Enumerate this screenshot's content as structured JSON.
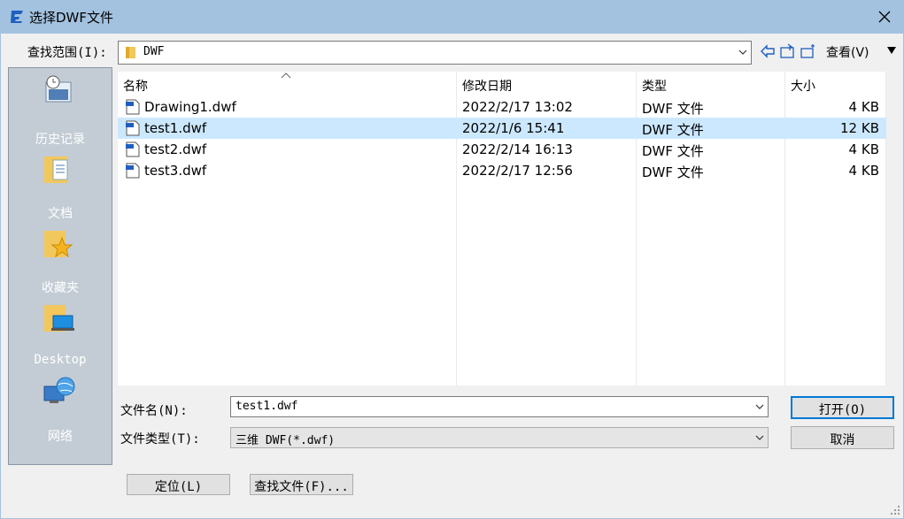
{
  "window": {
    "title": "选择DWF文件",
    "titlebar_color": "#a3c2e0",
    "icon": "app-logo-icon"
  },
  "lookin": {
    "label": "查找范围(I):",
    "value": "DWF"
  },
  "toolbar": {
    "views_label": "查看(V)",
    "icons": [
      "back-arrow-icon",
      "up-folder-icon",
      "new-folder-icon"
    ]
  },
  "places": [
    {
      "label": "历史记录",
      "icon": "history-icon"
    },
    {
      "label": "文档",
      "icon": "documents-icon"
    },
    {
      "label": "收藏夹",
      "icon": "favorites-icon"
    },
    {
      "label": "Desktop",
      "icon": "desktop-icon"
    },
    {
      "label": "网络",
      "icon": "network-icon"
    }
  ],
  "filelist": {
    "columns": [
      "名称",
      "修改日期",
      "类型",
      "大小"
    ],
    "rows": [
      {
        "name": "Drawing1.dwf",
        "date": "2022/2/17 13:02",
        "type": "DWF 文件",
        "size": "4 KB"
      },
      {
        "name": "test1.dwf",
        "date": "2022/1/6 15:41",
        "type": "DWF 文件",
        "size": "12 KB",
        "selected": true
      },
      {
        "name": "test2.dwf",
        "date": "2022/2/14 16:13",
        "type": "DWF 文件",
        "size": "4 KB"
      },
      {
        "name": "test3.dwf",
        "date": "2022/2/17 12:56",
        "type": "DWF 文件",
        "size": "4 KB"
      }
    ],
    "selected_color": "#cce8ff"
  },
  "filename": {
    "label": "文件名(N):",
    "value": "test1.dwf"
  },
  "filetype": {
    "label": "文件类型(T):",
    "value": "三维 DWF(*.dwf)"
  },
  "buttons": {
    "open": "打开(O)",
    "cancel": "取消",
    "locate": "定位(L)",
    "find": "查找文件(F)..."
  }
}
